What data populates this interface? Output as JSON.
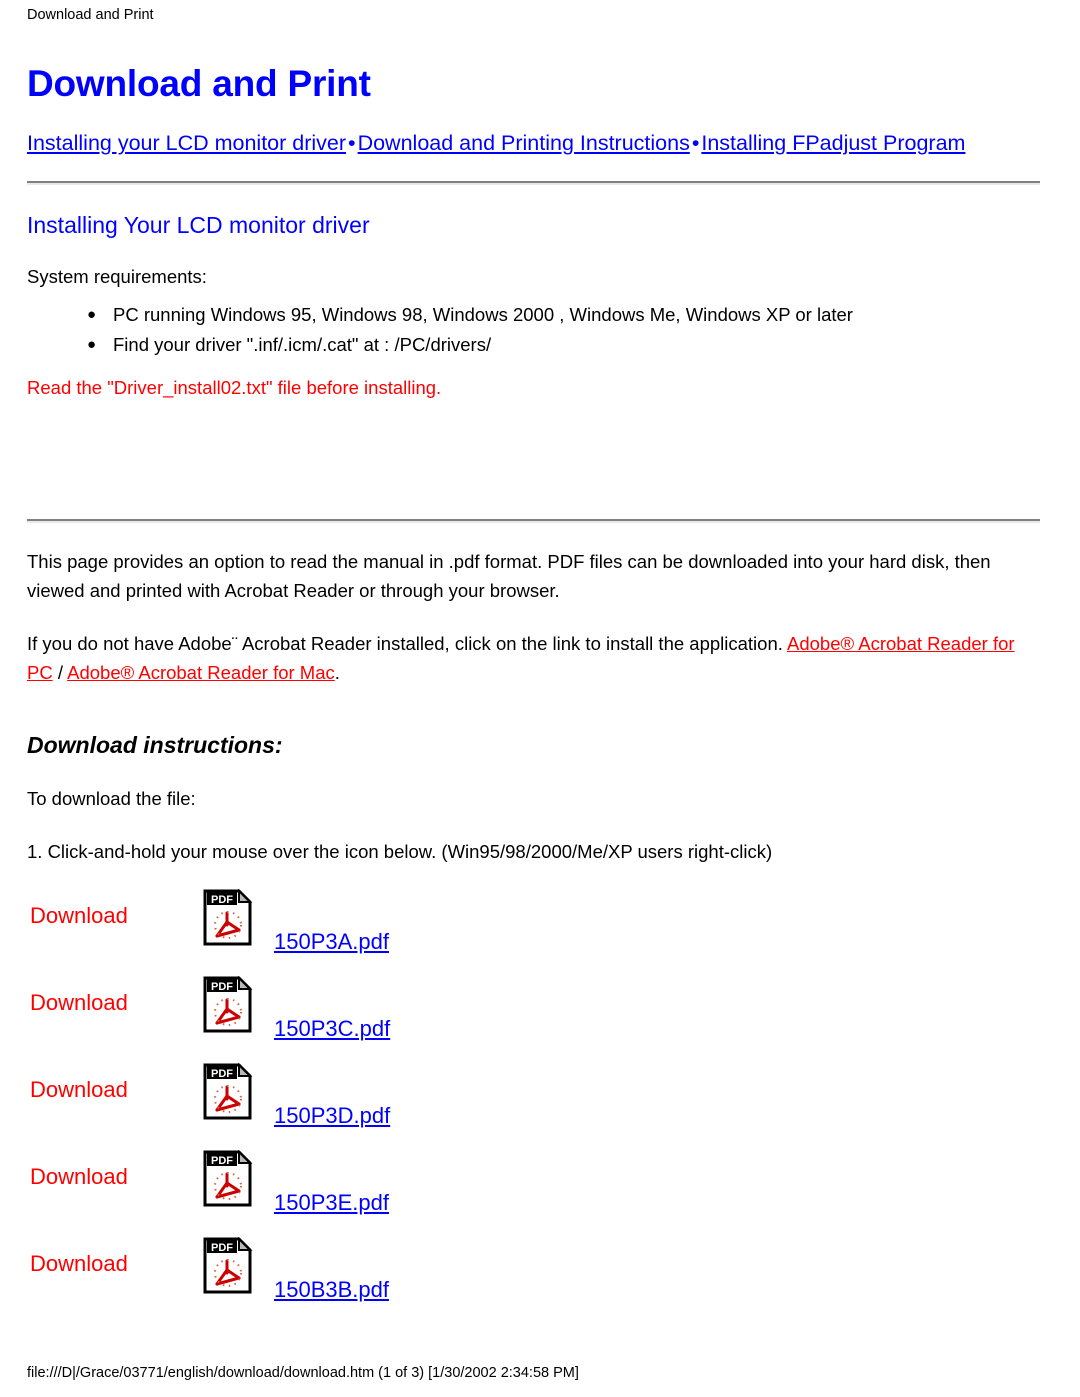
{
  "page_head": "Download and Print",
  "doc_title": "Download and Print",
  "nav": {
    "separator": "•",
    "links": [
      "Installing your LCD monitor driver",
      "Download and Printing Instructions",
      "Installing FPadjust Program"
    ]
  },
  "driver_section": {
    "heading": "Installing Your LCD monitor driver",
    "requirements_label": "System requirements:",
    "requirements": [
      "PC running Windows 95, Windows 98, Windows 2000 , Windows Me, Windows XP or later",
      "Find your driver \".inf/.icm/.cat\" at : /PC/drivers/"
    ],
    "warning": "Read the \"Driver_install02.txt\" file before installing."
  },
  "pdf_section": {
    "paragraph1": "This page provides an option to read the manual in .pdf format. PDF files can be downloaded into your hard disk, then viewed and printed with Acrobat Reader or through your browser.",
    "paragraph2_before": "If you do not have Adobe¨ Acrobat Reader installed, click on the link to install the application. ",
    "link_pc": "Adobe® Acrobat Reader for PC",
    "paragraph2_middle": " / ",
    "link_mac": "Adobe® Acrobat Reader for Mac",
    "paragraph2_after": "."
  },
  "download_section": {
    "heading": "Download instructions:",
    "to_download": "To download the file:",
    "step1": "1. Click-and-hold your mouse over the icon below. (Win95/98/2000/Me/XP users right-click)",
    "download_label": "Download",
    "icon_name": "pdf-file-icon",
    "icon_badge": "PDF",
    "files": [
      "150P3A.pdf",
      "150P3C.pdf",
      "150P3D.pdf",
      "150P3E.pdf",
      "150B3B.pdf"
    ]
  },
  "footer": {
    "status": "file:///D|/Grace/03771/english/download/download.htm (1 of 3) [1/30/2002 2:34:58 PM]"
  },
  "colors": {
    "link_blue": "#0000ff",
    "alert_red": "#ff0000",
    "text_black": "#000000",
    "rule_gray": "#808080"
  }
}
